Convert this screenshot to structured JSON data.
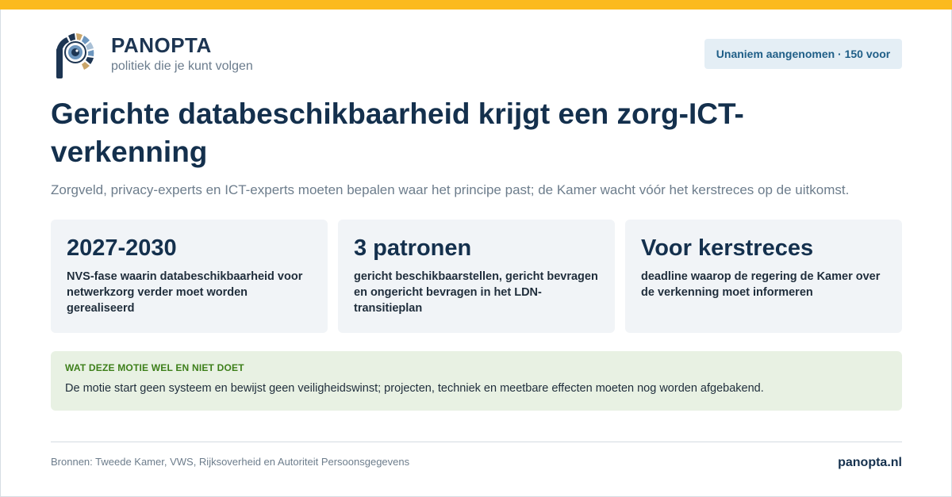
{
  "brand": {
    "name": "PANOPTA",
    "tagline": "politiek die je kunt volgen",
    "logo_icon": "panopta-eye-logo-icon",
    "accent_color": "#fbba1e"
  },
  "status": {
    "label": "Unaniem aangenomen · 150 voor"
  },
  "article": {
    "title": "Gerichte databeschikbaarheid krijgt een zorg-ICT-verkenning",
    "subtitle": "Zorgveld, privacy-experts en ICT-experts moeten bepalen waar het principe past; de Kamer wacht vóór het kerstreces op de uitkomst."
  },
  "stats": [
    {
      "value": "2027-2030",
      "description": "NVS-fase waarin databeschikbaarheid voor netwerkzorg verder moet worden gerealiseerd"
    },
    {
      "value": "3 patronen",
      "description": "gericht beschikbaarstellen, gericht bevragen en ongericht bevragen in het LDN-transitieplan"
    },
    {
      "value": "Voor kerstreces",
      "description": "deadline waarop de regering de Kamer over de verkenning moet informeren"
    }
  ],
  "note": {
    "label": "WAT DEZE MOTIE WEL EN NIET DOET",
    "text": "De motie start geen systeem en bewijst geen veiligheidswinst; projecten, techniek en meetbare effecten moeten nog worden afgebakend."
  },
  "footer": {
    "sources": "Bronnen: Tweede Kamer, VWS, Rijksoverheid en Autoriteit Persoonsgegevens",
    "site": "panopta.nl"
  }
}
